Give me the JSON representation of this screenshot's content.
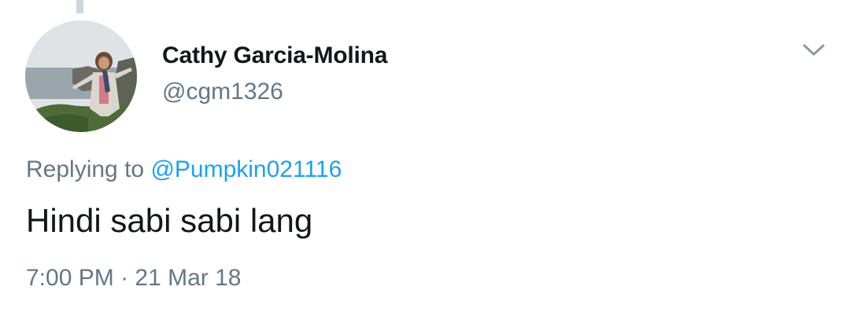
{
  "tweet": {
    "author": {
      "display_name": "Cathy Garcia-Molina",
      "handle": "@cgm1326"
    },
    "replying_prefix": "Replying to",
    "replying_to": "@Pumpkin021116",
    "text": "Hindi sabi sabi lang",
    "time": "7:00 PM",
    "separator": "·",
    "date": "21 Mar 18"
  },
  "icons": {
    "menu_caret": "chevron-down-icon"
  },
  "colors": {
    "text_primary": "#14171a",
    "text_secondary": "#657786",
    "link": "#1da1f2",
    "thread_line": "#ccd6dd"
  }
}
